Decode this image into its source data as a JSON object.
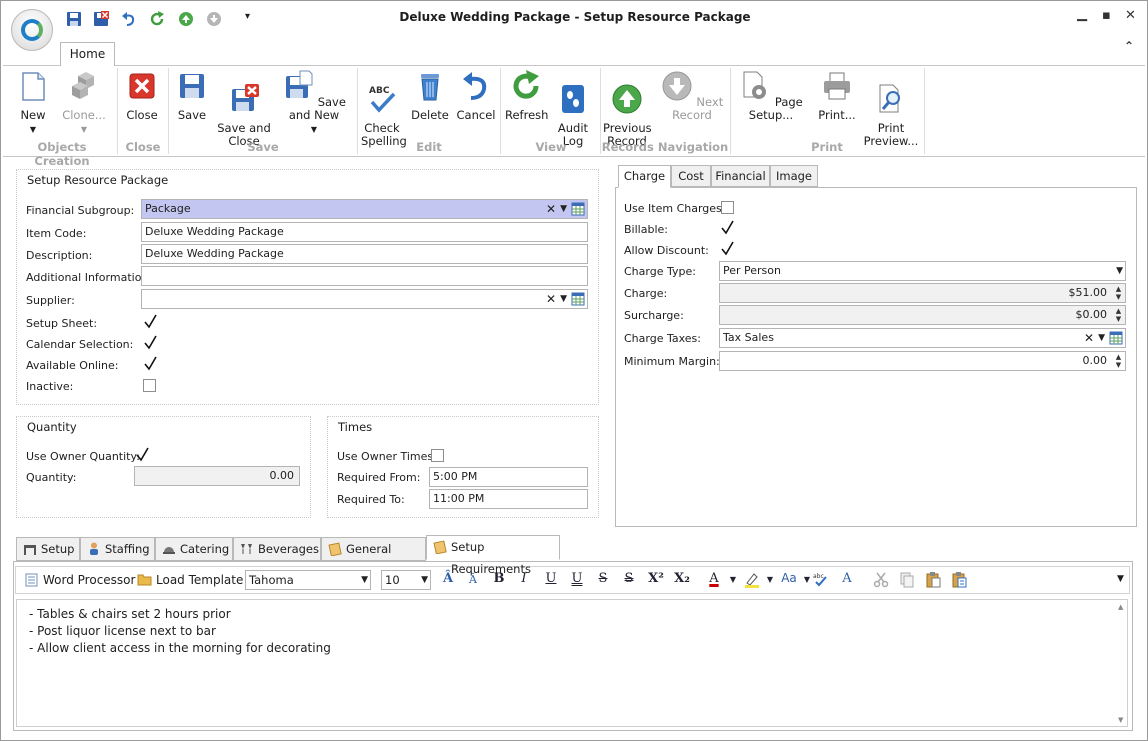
{
  "window": {
    "title": "Deluxe Wedding Package - Setup Resource Package"
  },
  "ribbon": {
    "tab_home": "Home",
    "buttons": {
      "new": "New",
      "clone": "Clone...",
      "close": "Close",
      "save": "Save",
      "save_and_close": "Save and\nClose",
      "save_and_new": "Save and New",
      "check_spelling": "Check\nSpelling",
      "delete": "Delete",
      "cancel": "Cancel",
      "refresh": "Refresh",
      "audit_log": "Audit\nLog",
      "previous_record": "Previous\nRecord",
      "next_record": "Next Record",
      "page_setup": "Page Setup...",
      "print": "Print...",
      "print_preview": "Print\nPreview..."
    },
    "groups": {
      "objects_creation": "Objects Creation",
      "close": "Close",
      "save": "Save",
      "edit": "Edit",
      "view": "View",
      "records_navigation": "Records Navigation",
      "print": "Print"
    }
  },
  "setup": {
    "title": "Setup Resource Package",
    "financial_subgroup_label": "Financial Subgroup:",
    "financial_subgroup_value": "Package",
    "item_code_label": "Item Code:",
    "item_code_value": "Deluxe Wedding Package",
    "description_label": "Description:",
    "description_value": "Deluxe Wedding Package",
    "additional_info_label": "Additional Information:",
    "additional_info_value": "",
    "supplier_label": "Supplier:",
    "supplier_value": "",
    "setup_sheet_label": "Setup Sheet:",
    "setup_sheet": true,
    "calendar_selection_label": "Calendar Selection:",
    "calendar_selection": true,
    "available_online_label": "Available Online:",
    "available_online": true,
    "inactive_label": "Inactive:",
    "inactive": false
  },
  "quantity": {
    "title": "Quantity",
    "use_owner_label": "Use Owner Quantity:",
    "use_owner": true,
    "quantity_label": "Quantity:",
    "quantity_value": "0.00"
  },
  "times": {
    "title": "Times",
    "use_owner_label": "Use Owner Times:",
    "use_owner": false,
    "required_from_label": "Required From:",
    "required_from_value": "5:00 PM",
    "required_to_label": "Required To:",
    "required_to_value": "11:00 PM"
  },
  "charge_tabs": [
    "Charge",
    "Cost",
    "Financial",
    "Image"
  ],
  "charge": {
    "use_item_charges_label": "Use Item Charges:",
    "use_item_charges": false,
    "billable_label": "Billable:",
    "billable": true,
    "allow_discount_label": "Allow Discount:",
    "allow_discount": true,
    "charge_type_label": "Charge Type:",
    "charge_type_value": "Per Person",
    "charge_label": "Charge:",
    "charge_value": "$51.00",
    "surcharge_label": "Surcharge:",
    "surcharge_value": "$0.00",
    "charge_taxes_label": "Charge Taxes:",
    "charge_taxes_value": "Tax Sales",
    "minimum_margin_label": "Minimum Margin:",
    "minimum_margin_value": "0.00"
  },
  "bottom_tabs": [
    "Setup",
    "Staffing",
    "Catering",
    "Beverages",
    "General Notes",
    "Setup Requirements"
  ],
  "editor_toolbar": {
    "word_processor": "Word Processor",
    "load_template": "Load Template",
    "font": "Tahoma",
    "font_size": "10"
  },
  "editor": {
    "lines": [
      "- Tables & chairs set 2 hours prior",
      "- Post liquor license next to bar",
      "- Allow client access in the morning for decorating"
    ]
  },
  "colors": {
    "selected_field": "#c3c6f0",
    "accent_blue": "#1e7fc8",
    "green_nav": "#4aa84a",
    "red_close": "#d9372b"
  }
}
